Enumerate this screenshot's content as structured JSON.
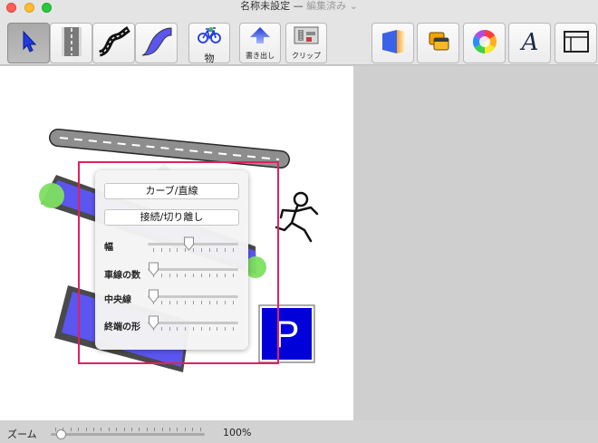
{
  "window": {
    "title": "名称未設定",
    "separator": "—",
    "status": "編集済み ⌄"
  },
  "toolbar": {
    "object_label": "物",
    "export_label": "書き出し",
    "clip_label": "クリップ"
  },
  "canvas": {
    "parking_sign": "P"
  },
  "popover": {
    "curve_button": "カーブ/直線",
    "connect_button": "接続/切り離し",
    "width_label": "幅",
    "width_value": 0.45,
    "lanes_label": "車線の数",
    "lanes_value": 0.0,
    "centerline_label": "中央線",
    "centerline_value": 0.0,
    "end_shape_label": "終端の形",
    "end_shape_value": 0.0
  },
  "bottombar": {
    "zoom_label": "ズーム",
    "zoom_value": "100%"
  },
  "colors": {
    "accent_blue": "#1f3adf",
    "road_blue": "#5b56f0",
    "handle_green": "#7de05f",
    "highlight_magenta": "#e0215e"
  }
}
